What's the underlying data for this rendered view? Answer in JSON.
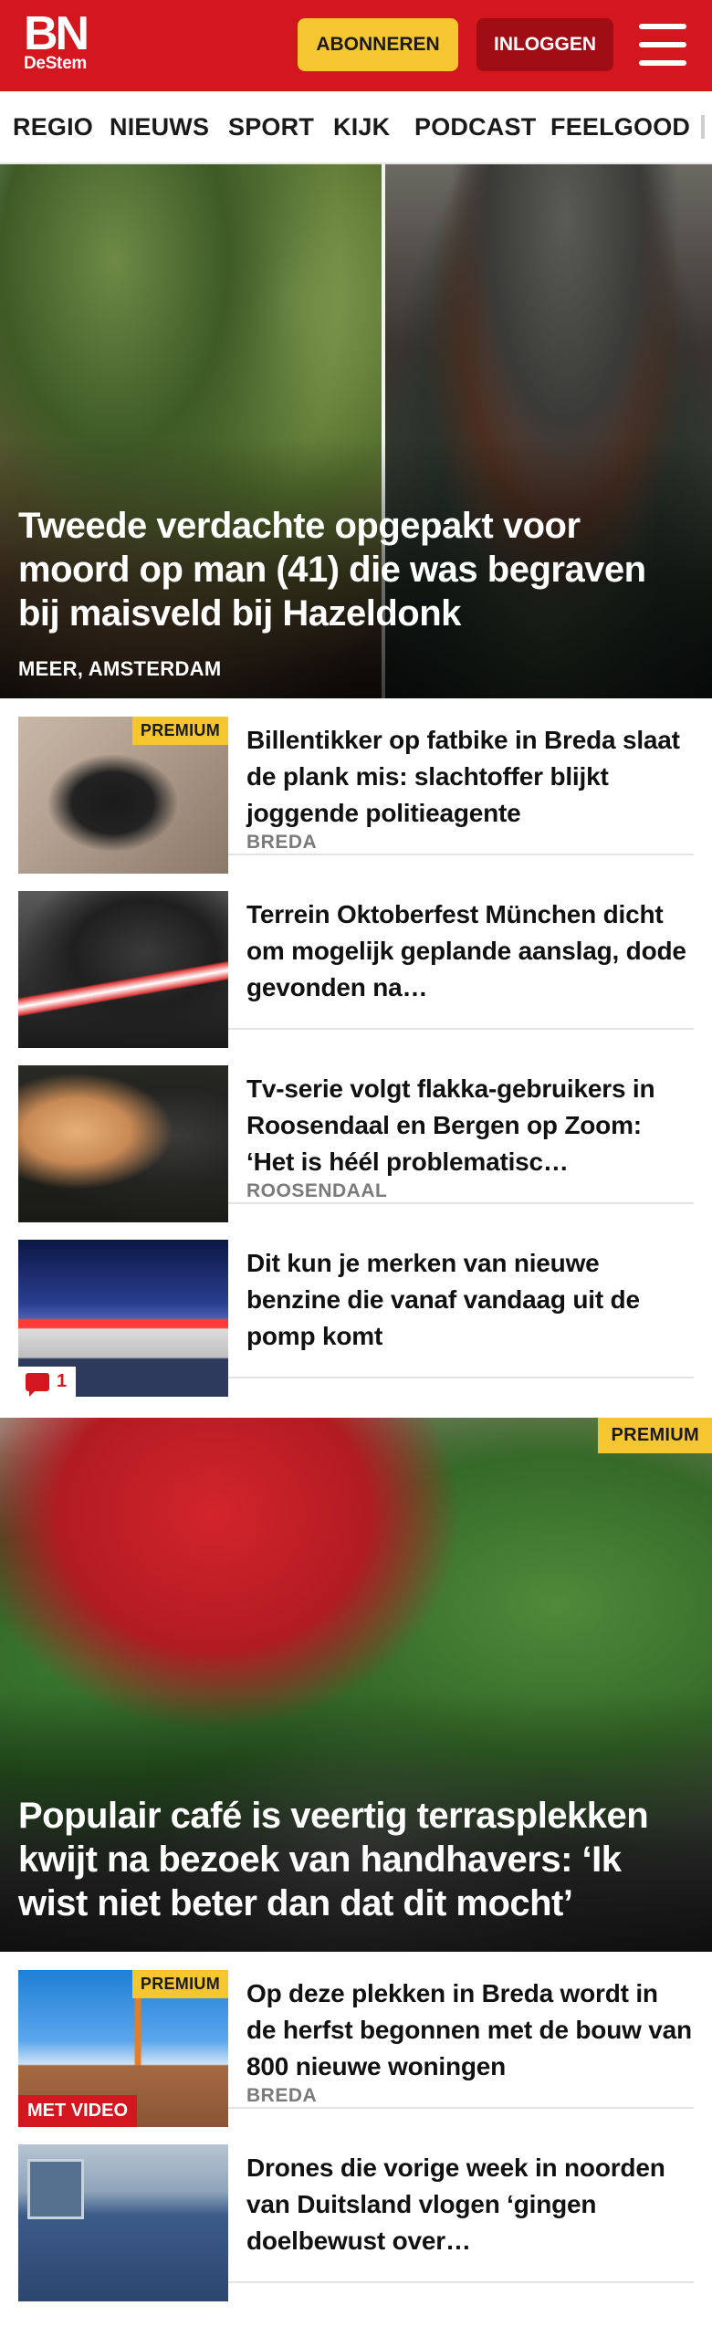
{
  "brand": {
    "logo_main": "BN",
    "logo_sub": "DeStem",
    "color": "#d4161f"
  },
  "header": {
    "subscribe_label": "ABONNEREN",
    "login_label": "INLOGGEN",
    "menu_icon": "hamburger-icon"
  },
  "nav": {
    "items": [
      "REGIO",
      "NIEUWS",
      "SPORT",
      "KIJK",
      "PODCAST",
      "FEELGOOD"
    ]
  },
  "hero": {
    "title": "Tweede verdachte opgepakt voor moord op man (41) die was begraven bij maisveld bij Hazeldonk",
    "location": "MEER, AMSTERDAM"
  },
  "articles": [
    {
      "title": "Billentikker op fatbike in Breda slaat de plank mis: slachtoffer blijkt joggende politieagente",
      "location": "BREDA",
      "badge": "PREMIUM"
    },
    {
      "title": "Terrein Oktoberfest München dicht om mogelijk geplande aanslag, dode gevonden na…",
      "location": ""
    },
    {
      "title": "Tv-serie volgt flakka-gebruikers in Roosendaal en Bergen op Zoom: ‘Het is héél problematisc…",
      "location": "ROOSENDAAL"
    },
    {
      "title": "Dit kun je merken van nieuwe benzine die vanaf vandaag uit de pomp komt",
      "location": "",
      "comments": "1"
    }
  ],
  "feature": {
    "title": "Populair café is veertig terrasplekken kwijt na bezoek van handhavers: ‘Ik wist niet beter dan dat dit mocht’",
    "badge": "PREMIUM"
  },
  "articles2": [
    {
      "title": "Op deze plekken in Breda wordt in de herfst begonnen met de bouw van 800 nieuwe woningen",
      "location": "BREDA",
      "badge": "PREMIUM",
      "video": "MET VIDEO"
    },
    {
      "title": "Drones die vorige week in noorden van Duitsland vlogen ‘gingen doelbewust over…",
      "location": ""
    }
  ]
}
